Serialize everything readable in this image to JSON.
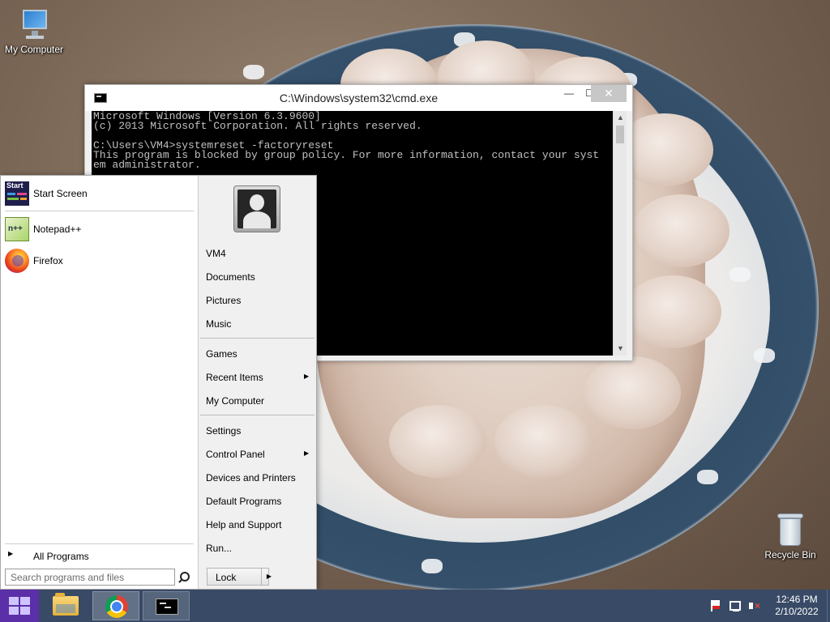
{
  "desktop": {
    "icons": [
      {
        "label": "My Computer",
        "icon": "computer-icon"
      },
      {
        "label": "Recycle Bin",
        "icon": "recycle-bin-icon"
      }
    ]
  },
  "cmd_window": {
    "title": "C:\\Windows\\system32\\cmd.exe",
    "minimize_label": "—",
    "maximize_label": "☐",
    "close_label": "✕",
    "console_lines": [
      "Microsoft Windows [Version 6.3.9600]",
      "(c) 2013 Microsoft Corporation. All rights reserved.",
      "",
      "C:\\Users\\VM4>systemreset -factoryreset",
      "This program is blocked by group policy. For more information, contact your syst",
      "em administrator."
    ]
  },
  "start_menu": {
    "pinned": [
      {
        "label": "Start Screen",
        "icon": "start-screen-icon"
      }
    ],
    "recent": [
      {
        "label": "Notepad++",
        "icon": "notepad-plus-plus-icon"
      },
      {
        "label": "Firefox",
        "icon": "firefox-icon"
      }
    ],
    "all_programs_label": "All Programs",
    "search_placeholder": "Search programs and files",
    "right_items": {
      "user": "VM4",
      "documents": "Documents",
      "pictures": "Pictures",
      "music": "Music",
      "games": "Games",
      "recent_items": "Recent Items",
      "my_computer": "My Computer",
      "settings": "Settings",
      "control_panel": "Control Panel",
      "devices_printers": "Devices and Printers",
      "default_programs": "Default Programs",
      "help_support": "Help and Support",
      "run": "Run..."
    },
    "lock_label": "Lock",
    "start_screen_icon_text": "Start"
  },
  "taskbar": {
    "apps": [
      {
        "name": "File Explorer",
        "icon": "file-explorer-icon"
      },
      {
        "name": "Google Chrome",
        "icon": "chrome-icon"
      },
      {
        "name": "Command Prompt",
        "icon": "cmd-icon"
      }
    ],
    "clock_time": "12:46 PM",
    "clock_date": "2/10/2022"
  },
  "colors": {
    "taskbar": "#384a66",
    "start_button": "#5b2fa8",
    "console_bg": "#000000",
    "console_text": "#c0c0c0"
  }
}
